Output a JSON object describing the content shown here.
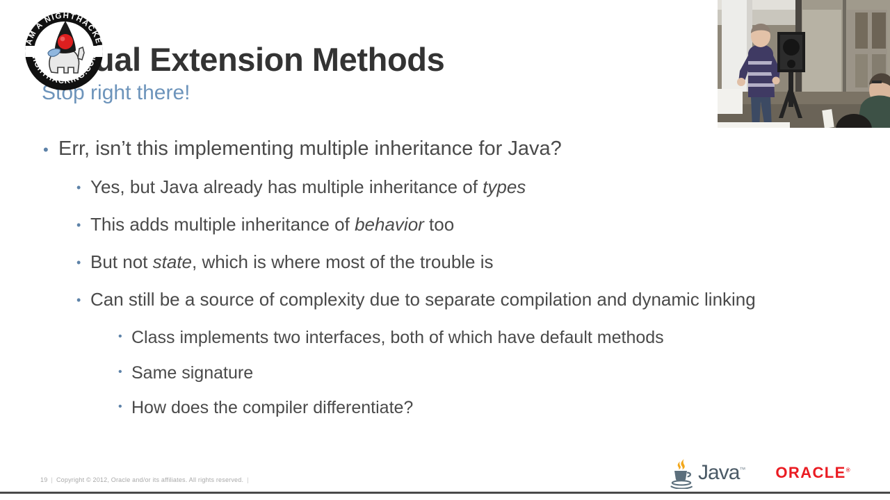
{
  "slide": {
    "title": "Virtual Extension Methods",
    "title_visible": "ual Extension Methods",
    "subtitle": "Stop right there!",
    "bullets": [
      {
        "level": 1,
        "text": "Err, isn’t this implementing multiple inheritance for Java?"
      },
      {
        "level": 2,
        "text_before": "Yes, but Java already has multiple inheritance of ",
        "italic": "types",
        "text_after": ""
      },
      {
        "level": 2,
        "text_before": "This adds multiple inheritance of ",
        "italic": "behavior",
        "text_after": " too"
      },
      {
        "level": 2,
        "text_before": "But not ",
        "italic": "state",
        "text_after": ", which is where most of the trouble is"
      },
      {
        "level": 2,
        "text": "Can still be a source of complexity due to separate compilation and dynamic linking"
      },
      {
        "level": 3,
        "text": "Class implements two interfaces, both of which have default methods"
      },
      {
        "level": 3,
        "text": "Same signature"
      },
      {
        "level": 3,
        "text": "How does the compiler differentiate?"
      }
    ]
  },
  "footer": {
    "page_number": "19",
    "separator": "|",
    "copyright": "Copyright © 2012, Oracle and/or its affiliates. All rights reserved.",
    "trailing_separator": "|"
  },
  "logos": {
    "nighthacker_top_arc": "I AM A NIGHTHACKER",
    "nighthacker_bottom_arc": "NIGHTHACKING.COM",
    "java_wordmark": "Java",
    "java_trademark": "™",
    "oracle_wordmark": "ORACLE",
    "oracle_trademark": "®"
  },
  "video": {
    "label": "presenter-video-pip",
    "description": "Live camera feed of speaker presenting beside a loudspeaker on a tripod, audience member seated at right"
  },
  "colors": {
    "title": "#333333",
    "subtitle": "#6d94bb",
    "body_text": "#4a4a4a",
    "bullet_dot": "#5d82a8",
    "footer_text": "#a9a9a9",
    "oracle_red": "#ea1b22",
    "java_blue": "#4b5a66",
    "background": "#ffffff",
    "bottom_rule": "#4a4a4a"
  },
  "bullet_glyph": "•"
}
